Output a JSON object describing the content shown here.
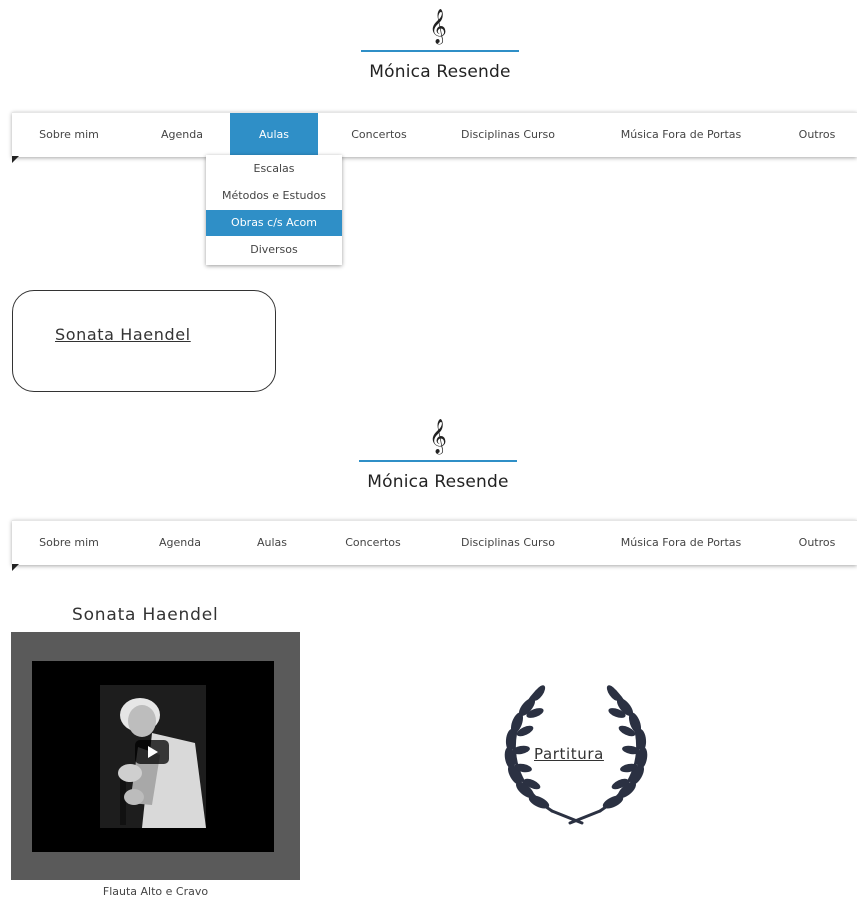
{
  "site": {
    "clef_symbol": "𝄞",
    "title": "Mónica Resende"
  },
  "nav": {
    "items": [
      "Sobre mim",
      "Agenda",
      "Aulas",
      "Concertos",
      "Disciplinas Curso",
      "Música Fora de Portas",
      "Outros"
    ],
    "active_top": "Aulas"
  },
  "dropdown": {
    "items": [
      "Escalas",
      "Métodos e Estudos",
      "Obras c/s Acom",
      "Diversos"
    ],
    "active": "Obras c/s Acom"
  },
  "card": {
    "link_label": "Sonata Haendel"
  },
  "detail": {
    "title": "Sonata Haendel",
    "video_caption": "Flauta Alto e Cravo",
    "partitura_label": "Partitura"
  },
  "colors": {
    "accent": "#2f8fc7",
    "video_frame": "#5a5a5a",
    "wreath": "#2b3142"
  },
  "icons": {
    "clef": "treble-clef-icon",
    "play": "play-icon",
    "wreath": "laurel-wreath-icon"
  }
}
